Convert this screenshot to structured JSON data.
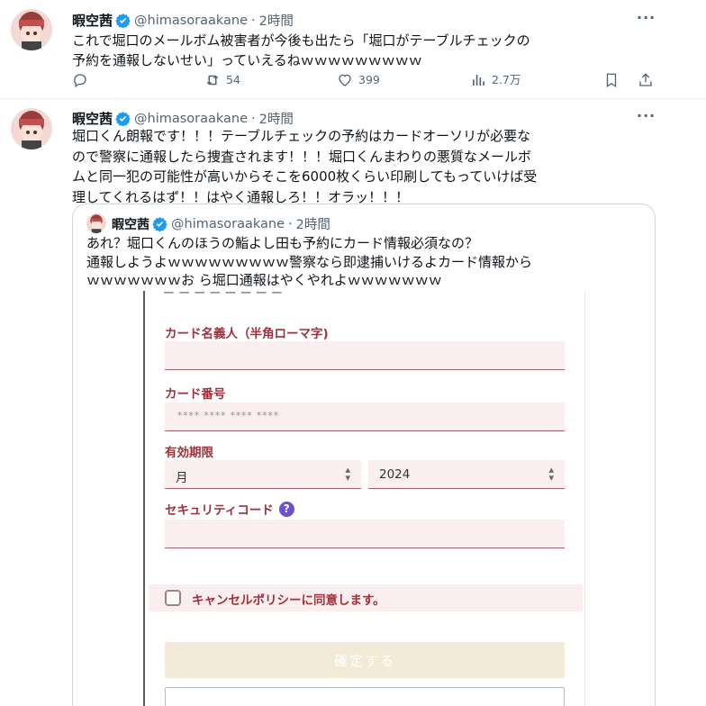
{
  "tweets": [
    {
      "name": "暇空茜",
      "handle": "@himasoraakane",
      "dot": "·",
      "time": "2時間",
      "more": "···",
      "lines": [
        "これで堀口のメールボム被害者が今後も出たら「堀口がテーブルチェックの",
        "予約を通報しないせい」っていえるねｗｗｗｗｗｗｗｗｗ"
      ],
      "stats": {
        "replies": "",
        "retweets": "54",
        "likes": "399",
        "views": "2.7万"
      }
    },
    {
      "name": "暇空茜",
      "handle": "@himasoraakane",
      "dot": "·",
      "time": "2時間",
      "more": "···",
      "lines": [
        "堀口くん朗報です！！！テーブルチェックの予約はカードオーソリが必要な",
        "ので警察に通報したら捜査されます！！！堀口くんまわりの悪質なメールボ",
        "ムと同一犯の可能性が高いからそこを6000枚くらい印刷してもっていけば受",
        "理してくれるはず！！はやく通報しろ！！オラッ！！！"
      ]
    }
  ],
  "quote": {
    "name": "暇空茜",
    "handle": "@himasoraakane",
    "dot": "·",
    "time": "2時間",
    "lines": [
      "あれ？堀口くんのほうの鮨よし田も予約にカード情報必須なの？",
      "通報しようよｗｗｗｗｗｗｗｗｗ警察なら即逮捕いけるよカード情報から",
      "ｗｗｗｗｗｗｗお ら堀口通報はやくやれよｗｗｗｗｗｗｗ"
    ],
    "form": {
      "cardholder_label": "カード名義人（半角ローマ字)",
      "card_number_label": "カード番号",
      "card_number_placeholder": "**** **** **** ****",
      "expiry_label": "有効期限",
      "month_value": "月",
      "year_value": "2024",
      "security_label": "セキュリティコード",
      "help_glyph": "?",
      "agree_text": "キャンセルポリシーに同意します。",
      "confirm_label": "確定する"
    }
  },
  "colors": {
    "text": "#0f1419",
    "muted": "#536471",
    "verified": "#1d9bf0",
    "form_label": "#a0303a",
    "form_field": "#fbeeee"
  }
}
